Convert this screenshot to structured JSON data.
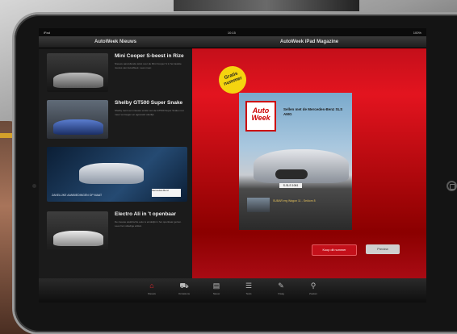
{
  "status_bar": {
    "left": "iPad",
    "time": "10:15",
    "right": "100%"
  },
  "nav": {
    "left_title": "AutoWeek Nieuws",
    "right_title": "AutoWeek iPad Magazine"
  },
  "articles": [
    {
      "title": "Mini Cooper S-beest in Rize",
      "body": "Nieuwe aanvullende tekst over de Mini Cooper S in het laatste nieuws van AutoWeek. Lees meer."
    },
    {
      "title": "Shelby GT500 Super Snake",
      "body": "Shelby toont een nieuwe versie van de GT500 Super Snake met meer vermogen en agressief uiterlijk."
    },
    {
      "title": "Electro Ali in 't openbaar",
      "body": "De nieuwe elektrische auto is eindelijk in het openbaar gezien. Lees het volledige artikel."
    }
  ],
  "ad": {
    "text": "ZAKELIJKE AANBIEDINGEN OP MAAT",
    "logo": "Mercedes-Benz"
  },
  "magazine": {
    "badge": "Gratis nummer",
    "logo": "Auto Week",
    "headline": "Sellen met de Mercedes-Benz SLS AMG",
    "plate": "S-SLS 1061",
    "inset_text": "SUBAR erg Wagon 11 - Seldom 8"
  },
  "buttons": {
    "buy": "Koop dit nummer",
    "preview": "Preview"
  },
  "tabs": [
    {
      "label": "Nieuws",
      "icon": "home-icon"
    },
    {
      "label": "Occasions",
      "icon": "car-icon"
    },
    {
      "label": "Nieuw",
      "icon": "document-icon"
    },
    {
      "label": "Tests",
      "icon": "stack-icon"
    },
    {
      "label": "Vraag",
      "icon": "pen-icon"
    },
    {
      "label": "Zoeken",
      "icon": "search-icon"
    }
  ]
}
